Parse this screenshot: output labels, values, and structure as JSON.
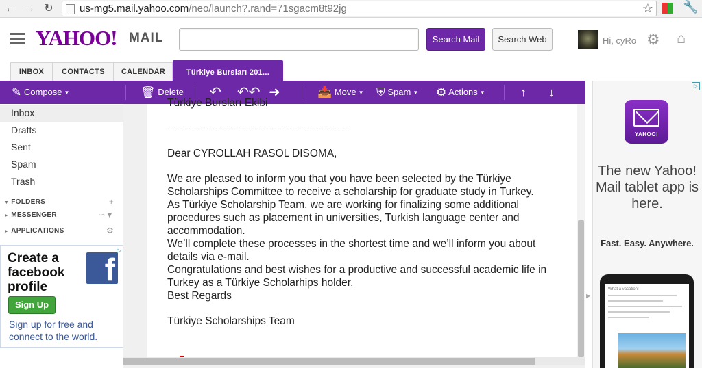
{
  "browser": {
    "url_host": "us-mg5.mail.yahoo.com",
    "url_rest": "/neo/launch?.rand=71sgacm8t92jg"
  },
  "header": {
    "logo": "YAHOO!",
    "logo_suffix": "MAIL",
    "search_placeholder": "",
    "search_mail_label": "Search Mail",
    "search_web_label": "Search Web",
    "greeting": "Hi, cyRo"
  },
  "tabs": [
    {
      "label": "INBOX"
    },
    {
      "label": "CONTACTS"
    },
    {
      "label": "CALENDAR"
    },
    {
      "label": "Türkiye Bursları 201..."
    }
  ],
  "toolbar": {
    "compose": "Compose",
    "delete": "Delete",
    "move": "Move",
    "spam": "Spam",
    "actions": "Actions"
  },
  "sidebar": {
    "folders": [
      {
        "label": "Inbox"
      },
      {
        "label": "Drafts"
      },
      {
        "label": "Sent"
      },
      {
        "label": "Spam"
      },
      {
        "label": "Trash"
      }
    ],
    "sections": [
      {
        "label": "FOLDERS"
      },
      {
        "label": "MESSENGER"
      },
      {
        "label": "APPLICATIONS"
      }
    ]
  },
  "fb_ad": {
    "headline": "Create a facebook profile",
    "button": "Sign Up",
    "subtext": "Sign up for free and connect to the world."
  },
  "message": {
    "top_partial": "Türkiye Bursları Ekibi",
    "divider": "--------------------------------------------------------------",
    "greeting": "Dear  CYROLLAH RASOL DISOMA,",
    "lines": [
      "We are pleased to inform you that you have been selected by the Türkiye",
      "Scholarships Committee to receive a scholarship for graduate study in Turkey.",
      "As Türkiye Scholarship Team, we are working for finalizing some additional",
      "procedures such as placement in universities, Turkish language center and",
      "accommodation.",
      "We’ll complete these processes in the shortest time and we’ll inform you about",
      "details via e-mail.",
      "Congratulations and best wishes for a productive and successful academic life in",
      "Turkey as a Türkiye Scholarhips holder.",
      "Best Regards"
    ],
    "signature": "Türkiye Scholarships Team"
  },
  "right_ad": {
    "app_icon_label": "YAHOO!",
    "headline": "The new Yahoo! Mail tablet app is here.",
    "tagline": "Fast. Easy. Anywhere.",
    "tablet_title": "What a vacation!"
  },
  "colors": {
    "brand_purple": "#6d28a8",
    "facebook_blue": "#3b5998",
    "signup_green": "#42a53b"
  }
}
